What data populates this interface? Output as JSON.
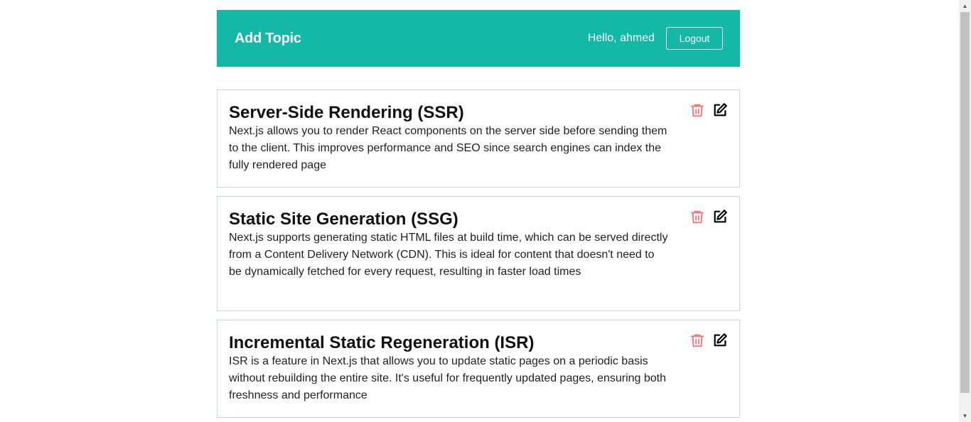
{
  "navbar": {
    "brand": "Add Topic",
    "greeting": "Hello, ahmed",
    "logout_label": "Logout",
    "background_color": "#14b8a6"
  },
  "topics": [
    {
      "title": "Server-Side Rendering (SSR)",
      "description": "Next.js allows you to render React components on the server side before sending them to the client. This improves performance and SEO since search engines can index the fully rendered page"
    },
    {
      "title": "Static Site Generation (SSG)",
      "description": "Next.js supports generating static HTML files at build time, which can be served directly from a Content Delivery Network (CDN). This is ideal for content that doesn't need to be dynamically fetched for every request, resulting in faster load times"
    },
    {
      "title": "Incremental Static Regeneration (ISR)",
      "description": "ISR is a feature in Next.js that allows you to update static pages on a periodic basis without rebuilding the entire site. It's useful for frequently updated pages, ensuring both freshness and performance"
    }
  ],
  "icons": {
    "delete": "trash-icon",
    "edit": "edit-icon",
    "delete_color": "#f87171",
    "edit_color": "#000000"
  }
}
